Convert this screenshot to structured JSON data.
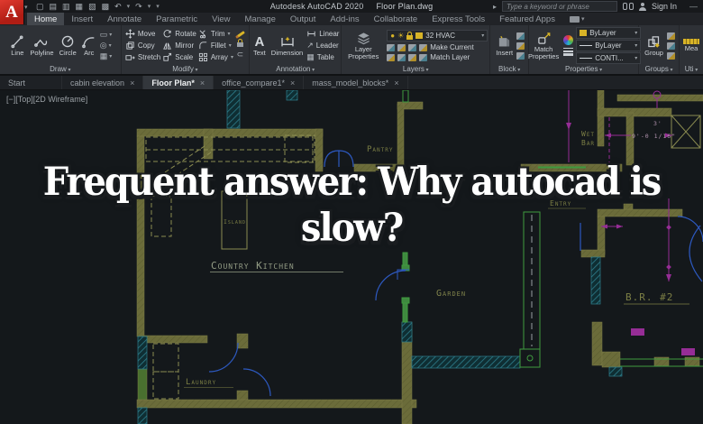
{
  "titlebar": {
    "app_title": "Autodesk AutoCAD 2020",
    "doc_title": "Floor Plan.dwg",
    "search_placeholder": "Type a keyword or phrase",
    "sign_in_label": "Sign In"
  },
  "icons": {
    "dropdown": "▾",
    "close": "×",
    "flyout": "▸",
    "minimize": "—",
    "undo": "↶",
    "redo": "↷",
    "new_doc": "▢",
    "open": "▤",
    "save": "▥",
    "save_as": "▦",
    "export": "▧",
    "plot": "▩",
    "logo_letter": "A",
    "text_tool_glyph": "A",
    "bulb": "●",
    "sun": "☀",
    "leader_glyph": "↗",
    "table_glyph": "▦",
    "rect_glyph": "▭",
    "ellipse_glyph": "◎",
    "hatch_glyph": "▦",
    "magnet_glyph": "⊂"
  },
  "ribbon": {
    "tabs": [
      {
        "label": "Home",
        "active": true
      },
      {
        "label": "Insert"
      },
      {
        "label": "Annotate"
      },
      {
        "label": "Parametric"
      },
      {
        "label": "View"
      },
      {
        "label": "Manage"
      },
      {
        "label": "Output"
      },
      {
        "label": "Add-ins"
      },
      {
        "label": "Collaborate"
      },
      {
        "label": "Express Tools"
      },
      {
        "label": "Featured Apps"
      }
    ]
  },
  "panels": {
    "draw": {
      "label": "Draw",
      "tools": [
        "Line",
        "Polyline",
        "Circle",
        "Arc"
      ]
    },
    "modify": {
      "label": "Modify",
      "col1": [
        "Move",
        "Copy",
        "Stretch"
      ],
      "col2": [
        "Rotate",
        "Mirror",
        "Scale"
      ],
      "col3": [
        "Trim",
        "Fillet",
        "Array"
      ]
    },
    "annotation": {
      "label": "Annotation",
      "text_tool": "Text",
      "dimension_tool": "Dimension",
      "col": [
        "Linear",
        "Leader",
        "Table"
      ]
    },
    "layers": {
      "label": "Layers",
      "big_tool": "Layer Properties",
      "current_layer": "32 HVAC",
      "row1": "Make Current",
      "row2": "Match Layer"
    },
    "block": {
      "label": "Block",
      "big_tool": "Insert"
    },
    "properties": {
      "label": "Properties",
      "big_tool": "Match Properties",
      "color": "ByLayer",
      "lineweight": "ByLayer",
      "linetype": "CONTI..."
    },
    "groups": {
      "label": "Groups",
      "big_tool": "Group"
    },
    "utilities": {
      "label": "Uti",
      "big_tool": "Mea"
    }
  },
  "doc_tabs": [
    {
      "label": "Start"
    },
    {
      "label": "cabin elevation"
    },
    {
      "label": "Floor Plan*",
      "active": true
    },
    {
      "label": "office_compare1*"
    },
    {
      "label": "mass_model_blocks*"
    }
  ],
  "viewport": {
    "controls_minus": "[−]",
    "controls_view": "[Top]",
    "controls_visual": "[2D Wireframe]"
  },
  "overlay": {
    "line1": "Frequent answer: Why autocad is",
    "line2": "slow?"
  },
  "drawing": {
    "labels": {
      "pantry": "Pantry",
      "wet1": "Wet",
      "wet2": "Bar",
      "island": "Island",
      "country_kitchen": "Country Kitchen",
      "garden": "Garden",
      "laundry": "Laundry",
      "bedroom2": "B.R. #2",
      "entry": "Entry"
    },
    "dimensions": {
      "d1": "9'-0 1/16\"",
      "d2": "3'"
    }
  },
  "colors": {
    "wall_olive": "#6b6c3a",
    "hatch_teal": "#2e7f8e",
    "door_blue": "#2d59c0",
    "dim_magenta": "#962d96",
    "label_olive": "#7c7f45",
    "label_sage": "#939c85",
    "canvas_bg": "#14181b",
    "accent_yellow": "#d8b427"
  }
}
